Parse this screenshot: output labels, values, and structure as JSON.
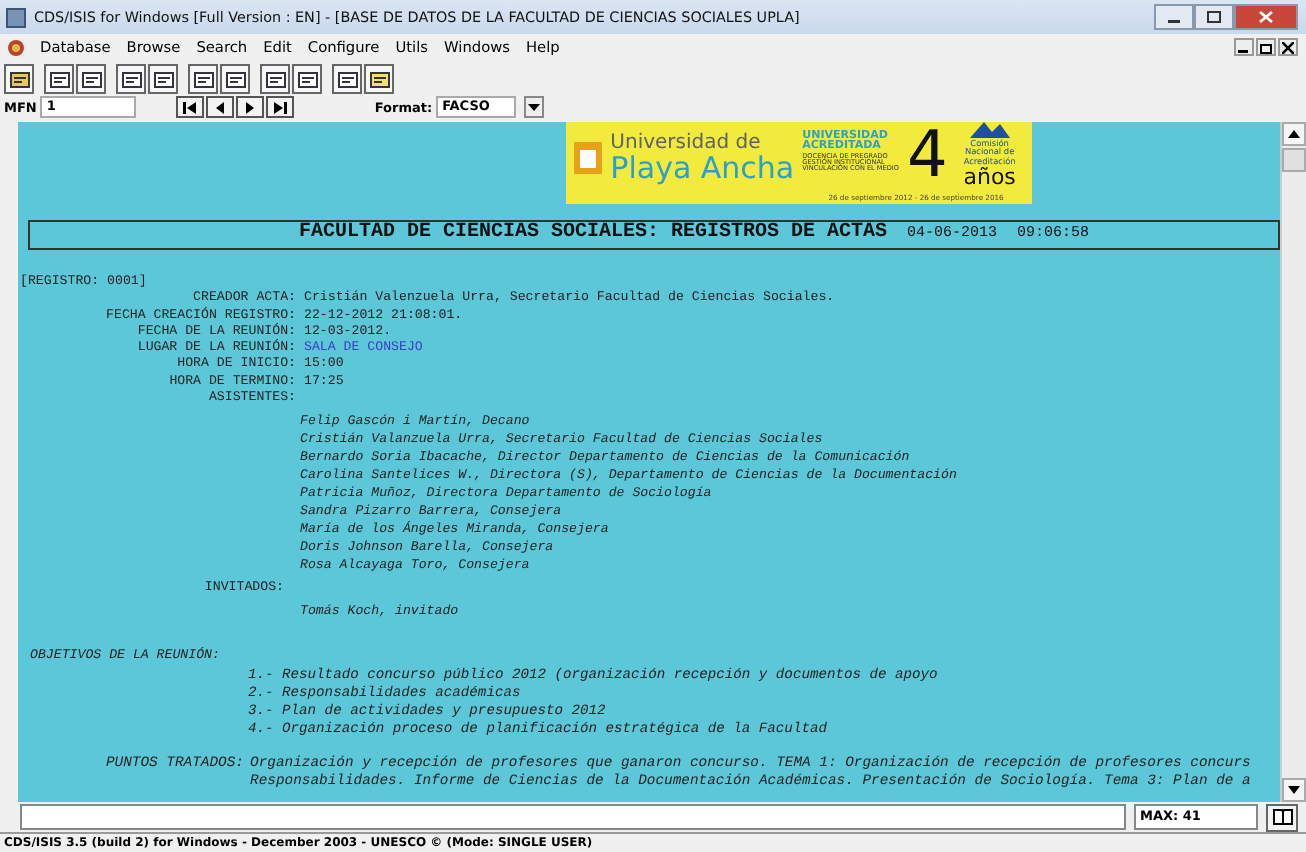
{
  "window": {
    "title": "CDS/ISIS for Windows [Full Version : EN] - [BASE DE DATOS DE LA FACULTAD DE CIENCIAS SOCIALES UPLA]"
  },
  "menu": [
    "Database",
    "Browse",
    "Search",
    "Edit",
    "Configure",
    "Utils",
    "Windows",
    "Help"
  ],
  "record_nav": {
    "mfn_label": "MFN",
    "mfn_value": "1",
    "format_label": "Format:",
    "format_value": "FACSO"
  },
  "banner": {
    "name_top": "Universidad de",
    "name_bottom": "Playa Ancha",
    "accredited": "UNIVERSIDAD ACREDITADA",
    "areas": [
      "DOCENCIA DE PREGRADO",
      "GESTIÓN INSTITUCIONAL",
      "VINCULACIÓN CON EL MEDIO"
    ],
    "years_number": "4",
    "years_word": "años",
    "agency": "Comisión Nacional de Acreditación",
    "period": "26 de septiembre 2012 - 26 de septiembre 2016"
  },
  "heading": {
    "title": "FACULTAD DE CIENCIAS SOCIALES: REGISTROS DE ACTAS",
    "date": "04-06-2013",
    "time": "09:06:58"
  },
  "record_id": "[REGISTRO: 0001]",
  "fields": [
    {
      "label": "CREADOR ACTA:",
      "value": "Cristián Valenzuela Urra, Secretario Facultad de Ciencias Sociales.",
      "kind": "text"
    },
    {
      "label": "FECHA CREACIÓN REGISTRO:",
      "value": "22-12-2012  21:08:01.",
      "kind": "text"
    },
    {
      "label": "FECHA DE LA REUNIÓN:",
      "value": "12-03-2012.",
      "kind": "text"
    },
    {
      "label": "LUGAR DE LA REUNIÓN:",
      "value": "SALA DE CONSEJO",
      "kind": "link"
    },
    {
      "label": "HORA DE INICIO:",
      "value": "15:00",
      "kind": "text"
    },
    {
      "label": "HORA DE TERMINO:",
      "value": "17:25",
      "kind": "text"
    }
  ],
  "attendees": {
    "label": "ASISTENTES:",
    "names": [
      "Felip Gascón i Martín, Decano",
      "Cristián Valanzuela Urra, Secretario Facultad de Ciencias Sociales",
      "Bernardo Soria Ibacache, Director Departamento de Ciencias de la Comunicación",
      "Carolina Santelices W., Directora (S), Departamento de Ciencias de la Documentación",
      "Patricia Muñoz, Directora Departamento de Sociología",
      "Sandra Pizarro Barrera, Consejera",
      "María de los Ángeles Miranda, Consejera",
      "Doris Johnson Barella, Consejera",
      "Rosa Alcayaga Toro, Consejera"
    ]
  },
  "guests": {
    "label": "INVITADOS:",
    "names": [
      "Tomás Koch, invitado"
    ]
  },
  "objectives": {
    "label": "OBJETIVOS DE LA REUNIÓN:",
    "items": [
      "1.- Resultado concurso público 2012 (organización recepción y documentos de apoyo",
      "2.- Responsabilidades académicas",
      "3.- Plan de actividades y presupuesto 2012",
      "4.- Organización proceso de planificación estratégica de la Facultad"
    ]
  },
  "topics": {
    "label": "PUNTOS TRATADOS:",
    "lines": [
      "Organización y recepción de profesores que ganaron concurso. TEMA 1: Organización de recepción de profesores concurs",
      "Responsabilidades. Informe de Ciencias de la Documentación Académicas. Presentación de Sociología. Tema 3: Plan de a"
    ]
  },
  "max": "MAX: 41",
  "status_bar": "CDS/ISIS 3.5 (build 2) for Windows - December 2003 - UNESCO © (Mode: SINGLE USER)"
}
